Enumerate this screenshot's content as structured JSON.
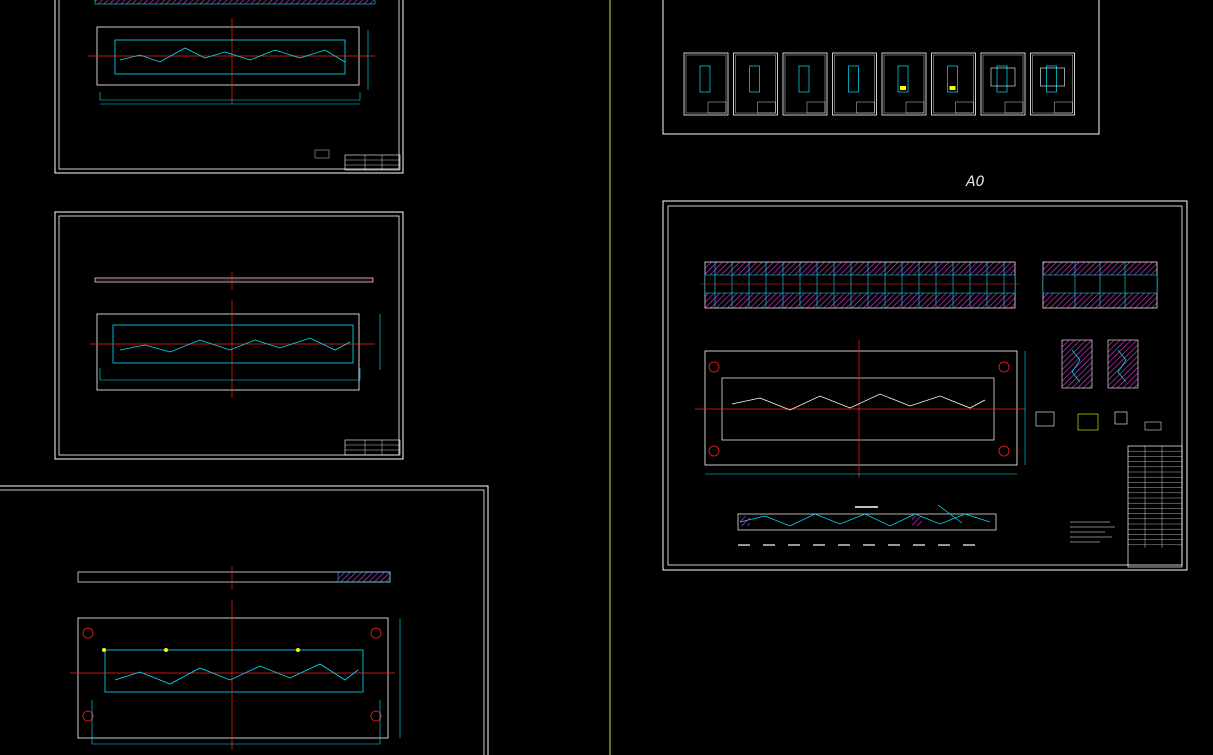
{
  "sheets": [
    {
      "id": "sheet-top-left"
    },
    {
      "id": "sheet-mid-left"
    },
    {
      "id": "sheet-bottom-left"
    },
    {
      "id": "sheet-top-right"
    },
    {
      "id": "sheet-main-right",
      "label": "A0"
    }
  ],
  "colors": {
    "background": "#000000",
    "frame": "#ffffff",
    "outline": "#00e5ff",
    "centerline": "#ff2020",
    "hatch": "#e040e0",
    "accent": "#ffff00",
    "divider": "#d8d860"
  },
  "thumbnail_sheets": 8
}
